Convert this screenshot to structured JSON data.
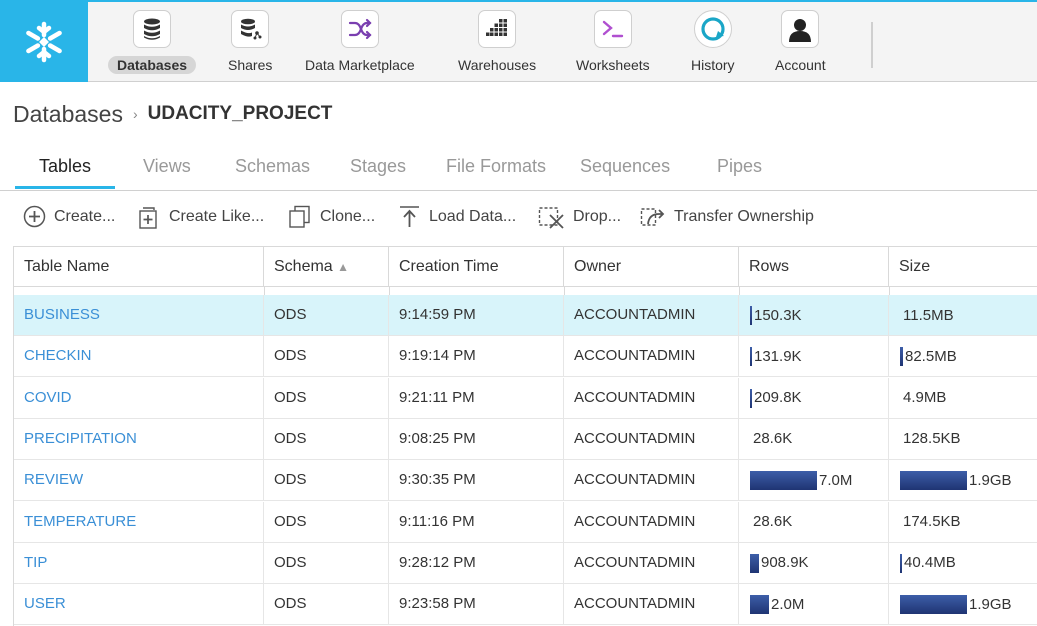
{
  "nav": {
    "items": [
      {
        "label": "Databases",
        "icon": "database-icon",
        "active": true
      },
      {
        "label": "Shares",
        "icon": "share-database-icon",
        "active": false
      },
      {
        "label": "Data Marketplace",
        "icon": "shuffle-icon",
        "active": false
      },
      {
        "label": "Warehouses",
        "icon": "warehouse-grid-icon",
        "active": false
      },
      {
        "label": "Worksheets",
        "icon": "terminal-icon",
        "active": false
      },
      {
        "label": "History",
        "icon": "history-refresh-icon",
        "active": false
      },
      {
        "label": "Account",
        "icon": "user-icon",
        "active": false
      }
    ]
  },
  "breadcrumb": {
    "root": "Databases",
    "separator": "›",
    "current": "UDACITY_PROJECT"
  },
  "tabs": [
    {
      "label": "Tables",
      "active": true
    },
    {
      "label": "Views"
    },
    {
      "label": "Schemas"
    },
    {
      "label": "Stages"
    },
    {
      "label": "File Formats"
    },
    {
      "label": "Sequences"
    },
    {
      "label": "Pipes"
    }
  ],
  "toolbar": {
    "create": "Create...",
    "create_like": "Create Like...",
    "clone": "Clone...",
    "load_data": "Load Data...",
    "drop": "Drop...",
    "transfer": "Transfer Ownership"
  },
  "table": {
    "headers": {
      "name": "Table Name",
      "schema": "Schema",
      "schema_sort": "▲",
      "created": "Creation Time",
      "owner": "Owner",
      "rows": "Rows",
      "size": "Size"
    },
    "rows": [
      {
        "name": "BUSINESS",
        "schema": "ODS",
        "created": "9:14:59 PM",
        "owner": "ACCOUNTADMIN",
        "rows": "150.3K",
        "rows_fraction": 0.02,
        "size": "11.5MB",
        "size_fraction": 0.0,
        "selected": true
      },
      {
        "name": "CHECKIN",
        "schema": "ODS",
        "created": "9:19:14 PM",
        "owner": "ACCOUNTADMIN",
        "rows": "131.9K",
        "rows_fraction": 0.02,
        "size": "82.5MB",
        "size_fraction": 0.04,
        "selected": false
      },
      {
        "name": "COVID",
        "schema": "ODS",
        "created": "9:21:11 PM",
        "owner": "ACCOUNTADMIN",
        "rows": "209.8K",
        "rows_fraction": 0.03,
        "size": "4.9MB",
        "size_fraction": 0.0,
        "selected": false
      },
      {
        "name": "PRECIPITATION",
        "schema": "ODS",
        "created": "9:08:25 PM",
        "owner": "ACCOUNTADMIN",
        "rows": "28.6K",
        "rows_fraction": 0.0,
        "size": "128.5KB",
        "size_fraction": 0.0,
        "selected": false
      },
      {
        "name": "REVIEW",
        "schema": "ODS",
        "created": "9:30:35 PM",
        "owner": "ACCOUNTADMIN",
        "rows": "7.0M",
        "rows_fraction": 1.0,
        "size": "1.9GB",
        "size_fraction": 1.0,
        "selected": false
      },
      {
        "name": "TEMPERATURE",
        "schema": "ODS",
        "created": "9:11:16 PM",
        "owner": "ACCOUNTADMIN",
        "rows": "28.6K",
        "rows_fraction": 0.0,
        "size": "174.5KB",
        "size_fraction": 0.0,
        "selected": false
      },
      {
        "name": "TIP",
        "schema": "ODS",
        "created": "9:28:12 PM",
        "owner": "ACCOUNTADMIN",
        "rows": "908.9K",
        "rows_fraction": 0.13,
        "size": "40.4MB",
        "size_fraction": 0.02,
        "selected": false
      },
      {
        "name": "USER",
        "schema": "ODS",
        "created": "9:23:58 PM",
        "owner": "ACCOUNTADMIN",
        "rows": "2.0M",
        "rows_fraction": 0.29,
        "size": "1.9GB",
        "size_fraction": 1.0,
        "selected": false
      }
    ]
  },
  "colors": {
    "brand": "#29b5e8",
    "link": "#3a8fd6",
    "selected_row": "#d8f4fa",
    "bar": "#2a4488"
  }
}
